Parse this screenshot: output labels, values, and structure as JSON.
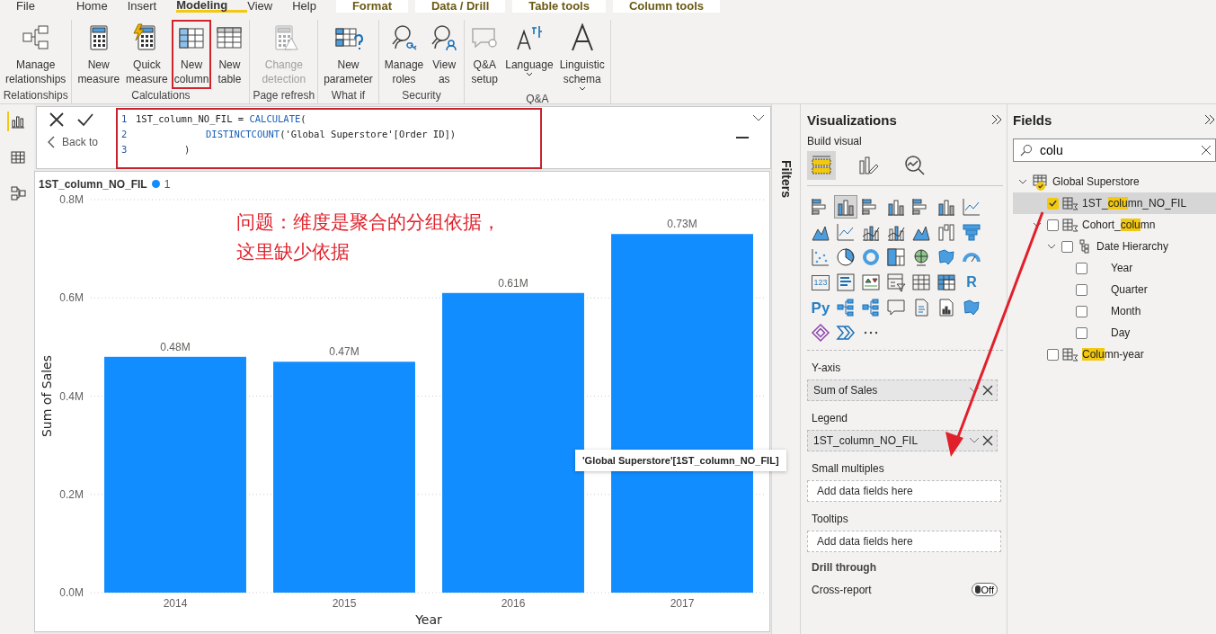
{
  "ribbon": {
    "tabs": [
      {
        "label": "File",
        "selected": false,
        "kind": "main"
      },
      {
        "label": "Home",
        "selected": false,
        "kind": "main"
      },
      {
        "label": "Insert",
        "selected": false,
        "kind": "main"
      },
      {
        "label": "Modeling",
        "selected": true,
        "kind": "main"
      },
      {
        "label": "View",
        "selected": false,
        "kind": "main"
      },
      {
        "label": "Help",
        "selected": false,
        "kind": "main"
      },
      {
        "label": "Format",
        "selected": false,
        "kind": "contextual"
      },
      {
        "label": "Data / Drill",
        "selected": false,
        "kind": "contextual"
      },
      {
        "label": "Table tools",
        "selected": false,
        "kind": "contextual"
      },
      {
        "label": "Column tools",
        "selected": false,
        "kind": "contextual"
      }
    ],
    "groups": [
      {
        "label": "Relationships",
        "buttons": [
          {
            "lines": [
              "Manage",
              "relationships"
            ],
            "kind": "relationships",
            "disabled": false,
            "highlighted": false,
            "dropdown": false
          }
        ]
      },
      {
        "label": "Calculations",
        "buttons": [
          {
            "lines": [
              "New",
              "measure"
            ],
            "kind": "measure",
            "disabled": false,
            "highlighted": false,
            "dropdown": false
          },
          {
            "lines": [
              "Quick",
              "measure"
            ],
            "kind": "quick-measure",
            "disabled": false,
            "highlighted": false,
            "dropdown": false
          },
          {
            "lines": [
              "New",
              "column"
            ],
            "kind": "column",
            "disabled": false,
            "highlighted": true,
            "dropdown": false
          },
          {
            "lines": [
              "New",
              "table"
            ],
            "kind": "table",
            "disabled": false,
            "highlighted": false,
            "dropdown": false
          }
        ]
      },
      {
        "label": "Page refresh",
        "buttons": [
          {
            "lines": [
              "Change",
              "detection"
            ],
            "kind": "detection",
            "disabled": true,
            "highlighted": false,
            "dropdown": false
          }
        ]
      },
      {
        "label": "What if",
        "buttons": [
          {
            "lines": [
              "New",
              "parameter"
            ],
            "kind": "parameter",
            "disabled": false,
            "highlighted": false,
            "dropdown": false
          }
        ]
      },
      {
        "label": "Security",
        "buttons": [
          {
            "lines": [
              "Manage",
              "roles"
            ],
            "kind": "roles",
            "disabled": false,
            "highlighted": false,
            "dropdown": false
          },
          {
            "lines": [
              "View",
              "as"
            ],
            "kind": "view-as",
            "disabled": false,
            "highlighted": false,
            "dropdown": false
          }
        ]
      },
      {
        "label": "Q&A",
        "buttons": [
          {
            "lines": [
              "Q&A",
              "setup"
            ],
            "kind": "qa-setup",
            "disabled": false,
            "highlighted": false,
            "dropdown": false
          },
          {
            "lines": [
              "Language"
            ],
            "kind": "language",
            "disabled": false,
            "highlighted": false,
            "dropdown": true
          },
          {
            "lines": [
              "Linguistic",
              "schema"
            ],
            "kind": "linguistic",
            "disabled": false,
            "highlighted": false,
            "dropdown": true
          }
        ]
      }
    ]
  },
  "rail": [
    {
      "kind": "report",
      "selected": true
    },
    {
      "kind": "data",
      "selected": false
    },
    {
      "kind": "model",
      "selected": false
    }
  ],
  "formula": {
    "back_label": "Back to",
    "highlighted": true,
    "lines": [
      {
        "number": "1",
        "kind": "statement",
        "segments": [
          {
            "text": "1ST_column_NO_FIL = ",
            "kind": "plain"
          },
          {
            "text": "CALCULATE",
            "kind": "function"
          },
          {
            "text": "(",
            "kind": "plain"
          }
        ]
      },
      {
        "number": "2",
        "kind": "argument",
        "segments": [
          {
            "text": "DISTINCTCOUNT",
            "kind": "function"
          },
          {
            "text": "('Global Superstore'[Order ID])",
            "kind": "plain"
          }
        ]
      },
      {
        "number": "3",
        "kind": "closing",
        "segments": [
          {
            "text": ")",
            "kind": "plain"
          }
        ]
      }
    ]
  },
  "chart": {
    "legend_title": "1ST_column_NO_FIL",
    "note": "问题：维度是聚合的分组依据，这里缺少依据",
    "chart_data": {
      "type": "bar",
      "xlabel": "Year",
      "ylabel": "Sum of Sales",
      "categories": [
        "2014",
        "2015",
        "2016",
        "2017"
      ],
      "series": [
        {
          "name": "1",
          "color": "#118dff",
          "values": [
            0.48,
            0.47,
            0.61,
            0.73
          ]
        }
      ],
      "grid": true,
      "ylim": [
        0,
        0.8
      ],
      "yticks": [
        {
          "value": 0,
          "label": "0.0M"
        },
        {
          "value": 0.2,
          "label": "0.2M"
        },
        {
          "value": 0.4,
          "label": "0.4M"
        },
        {
          "value": 0.6,
          "label": "0.6M"
        },
        {
          "value": 0.8,
          "label": "0.8M"
        }
      ],
      "value_labels": [
        "0.48M",
        "0.47M",
        "0.61M",
        "0.73M"
      ]
    }
  },
  "filters": {
    "label": "Filters"
  },
  "tooltip": "'Global Superstore'[1ST_column_NO_FIL]",
  "visualizations": {
    "title": "Visualizations",
    "subtitle": "Build visual",
    "modes": [
      {
        "kind": "fields",
        "selected": true
      },
      {
        "kind": "format",
        "selected": false
      },
      {
        "kind": "analytics",
        "selected": false
      }
    ],
    "gallery": [
      {
        "kind": "hbar",
        "selected": false
      },
      {
        "kind": "vbar",
        "selected": true
      },
      {
        "kind": "hbar",
        "selected": false
      },
      {
        "kind": "vbar",
        "selected": false
      },
      {
        "kind": "hbar",
        "selected": false
      },
      {
        "kind": "vbar",
        "selected": false
      },
      {
        "kind": "line",
        "selected": false
      },
      {
        "kind": "area",
        "selected": false
      },
      {
        "kind": "line",
        "selected": false
      },
      {
        "kind": "combo",
        "selected": false
      },
      {
        "kind": "combo",
        "selected": false
      },
      {
        "kind": "area",
        "selected": false
      },
      {
        "kind": "waterfall",
        "selected": false
      },
      {
        "kind": "funnel",
        "selected": false
      },
      {
        "kind": "scatter",
        "selected": false
      },
      {
        "kind": "pie",
        "selected": false
      },
      {
        "kind": "donut",
        "selected": false
      },
      {
        "kind": "treemap",
        "selected": false
      },
      {
        "kind": "globe",
        "selected": false
      },
      {
        "kind": "shape-map",
        "selected": false
      },
      {
        "kind": "gauge",
        "selected": false
      },
      {
        "kind": "number-card",
        "label": "123",
        "selected": false
      },
      {
        "kind": "list",
        "selected": false
      },
      {
        "kind": "kpi",
        "selected": false
      },
      {
        "kind": "slicer",
        "selected": false
      },
      {
        "kind": "table",
        "selected": false
      },
      {
        "kind": "matrix",
        "selected": false
      },
      {
        "kind": "r-script",
        "label": "R",
        "selected": false
      },
      {
        "kind": "python",
        "label": "Py",
        "selected": false
      },
      {
        "kind": "tree",
        "selected": false
      },
      {
        "kind": "tree",
        "selected": false
      },
      {
        "kind": "chat",
        "selected": false
      },
      {
        "kind": "doc",
        "selected": false
      },
      {
        "kind": "report",
        "selected": false
      },
      {
        "kind": "shape-map",
        "selected": false
      },
      {
        "kind": "diamond",
        "selected": false
      },
      {
        "kind": "chevrons",
        "selected": false
      },
      {
        "kind": "more",
        "selected": false
      }
    ],
    "wells": [
      {
        "label": "Y-axis",
        "field": "Sum of Sales"
      },
      {
        "label": "Legend",
        "field": "1ST_column_NO_FIL"
      },
      {
        "label": "Small multiples",
        "placeholder": "Add data fields here"
      },
      {
        "label": "Tooltips",
        "placeholder": "Add data fields here"
      }
    ],
    "drill": {
      "heading": "Drill through",
      "label": "Cross-report",
      "state": "Off",
      "on": false
    }
  },
  "fields": {
    "title": "Fields",
    "search": "colu",
    "tree": [
      {
        "kind": "table",
        "expanded": true,
        "checked": true,
        "selected": false,
        "segments": [
          {
            "text": "Global Superstore",
            "match": false
          }
        ],
        "children": [
          {
            "kind": "calc",
            "checked": true,
            "selected": true,
            "segments": [
              {
                "text": "1ST_",
                "match": false
              },
              {
                "text": "colu",
                "match": true
              },
              {
                "text": "mn_NO_FIL",
                "match": false
              }
            ]
          },
          {
            "kind": "calc",
            "expanded": true,
            "checked": false,
            "selected": false,
            "segments": [
              {
                "text": "Cohort_",
                "match": false
              },
              {
                "text": "colu",
                "match": true
              },
              {
                "text": "mn",
                "match": false
              }
            ],
            "children": [
              {
                "kind": "hierarchy",
                "expanded": true,
                "checked": false,
                "selected": false,
                "segments": [
                  {
                    "text": "Date Hierarchy",
                    "match": false
                  }
                ],
                "children": [
                  {
                    "checked": false,
                    "selected": false,
                    "segments": [
                      {
                        "text": "Year",
                        "match": false
                      }
                    ]
                  },
                  {
                    "checked": false,
                    "selected": false,
                    "segments": [
                      {
                        "text": "Quarter",
                        "match": false
                      }
                    ]
                  },
                  {
                    "checked": false,
                    "selected": false,
                    "segments": [
                      {
                        "text": "Month",
                        "match": false
                      }
                    ]
                  },
                  {
                    "checked": false,
                    "selected": false,
                    "segments": [
                      {
                        "text": "Day",
                        "match": false
                      }
                    ]
                  }
                ]
              }
            ]
          },
          {
            "kind": "calc",
            "checked": false,
            "selected": false,
            "segments": [
              {
                "text": "Colu",
                "match": true
              },
              {
                "text": "mn-year",
                "match": false
              }
            ]
          }
        ]
      }
    ]
  }
}
